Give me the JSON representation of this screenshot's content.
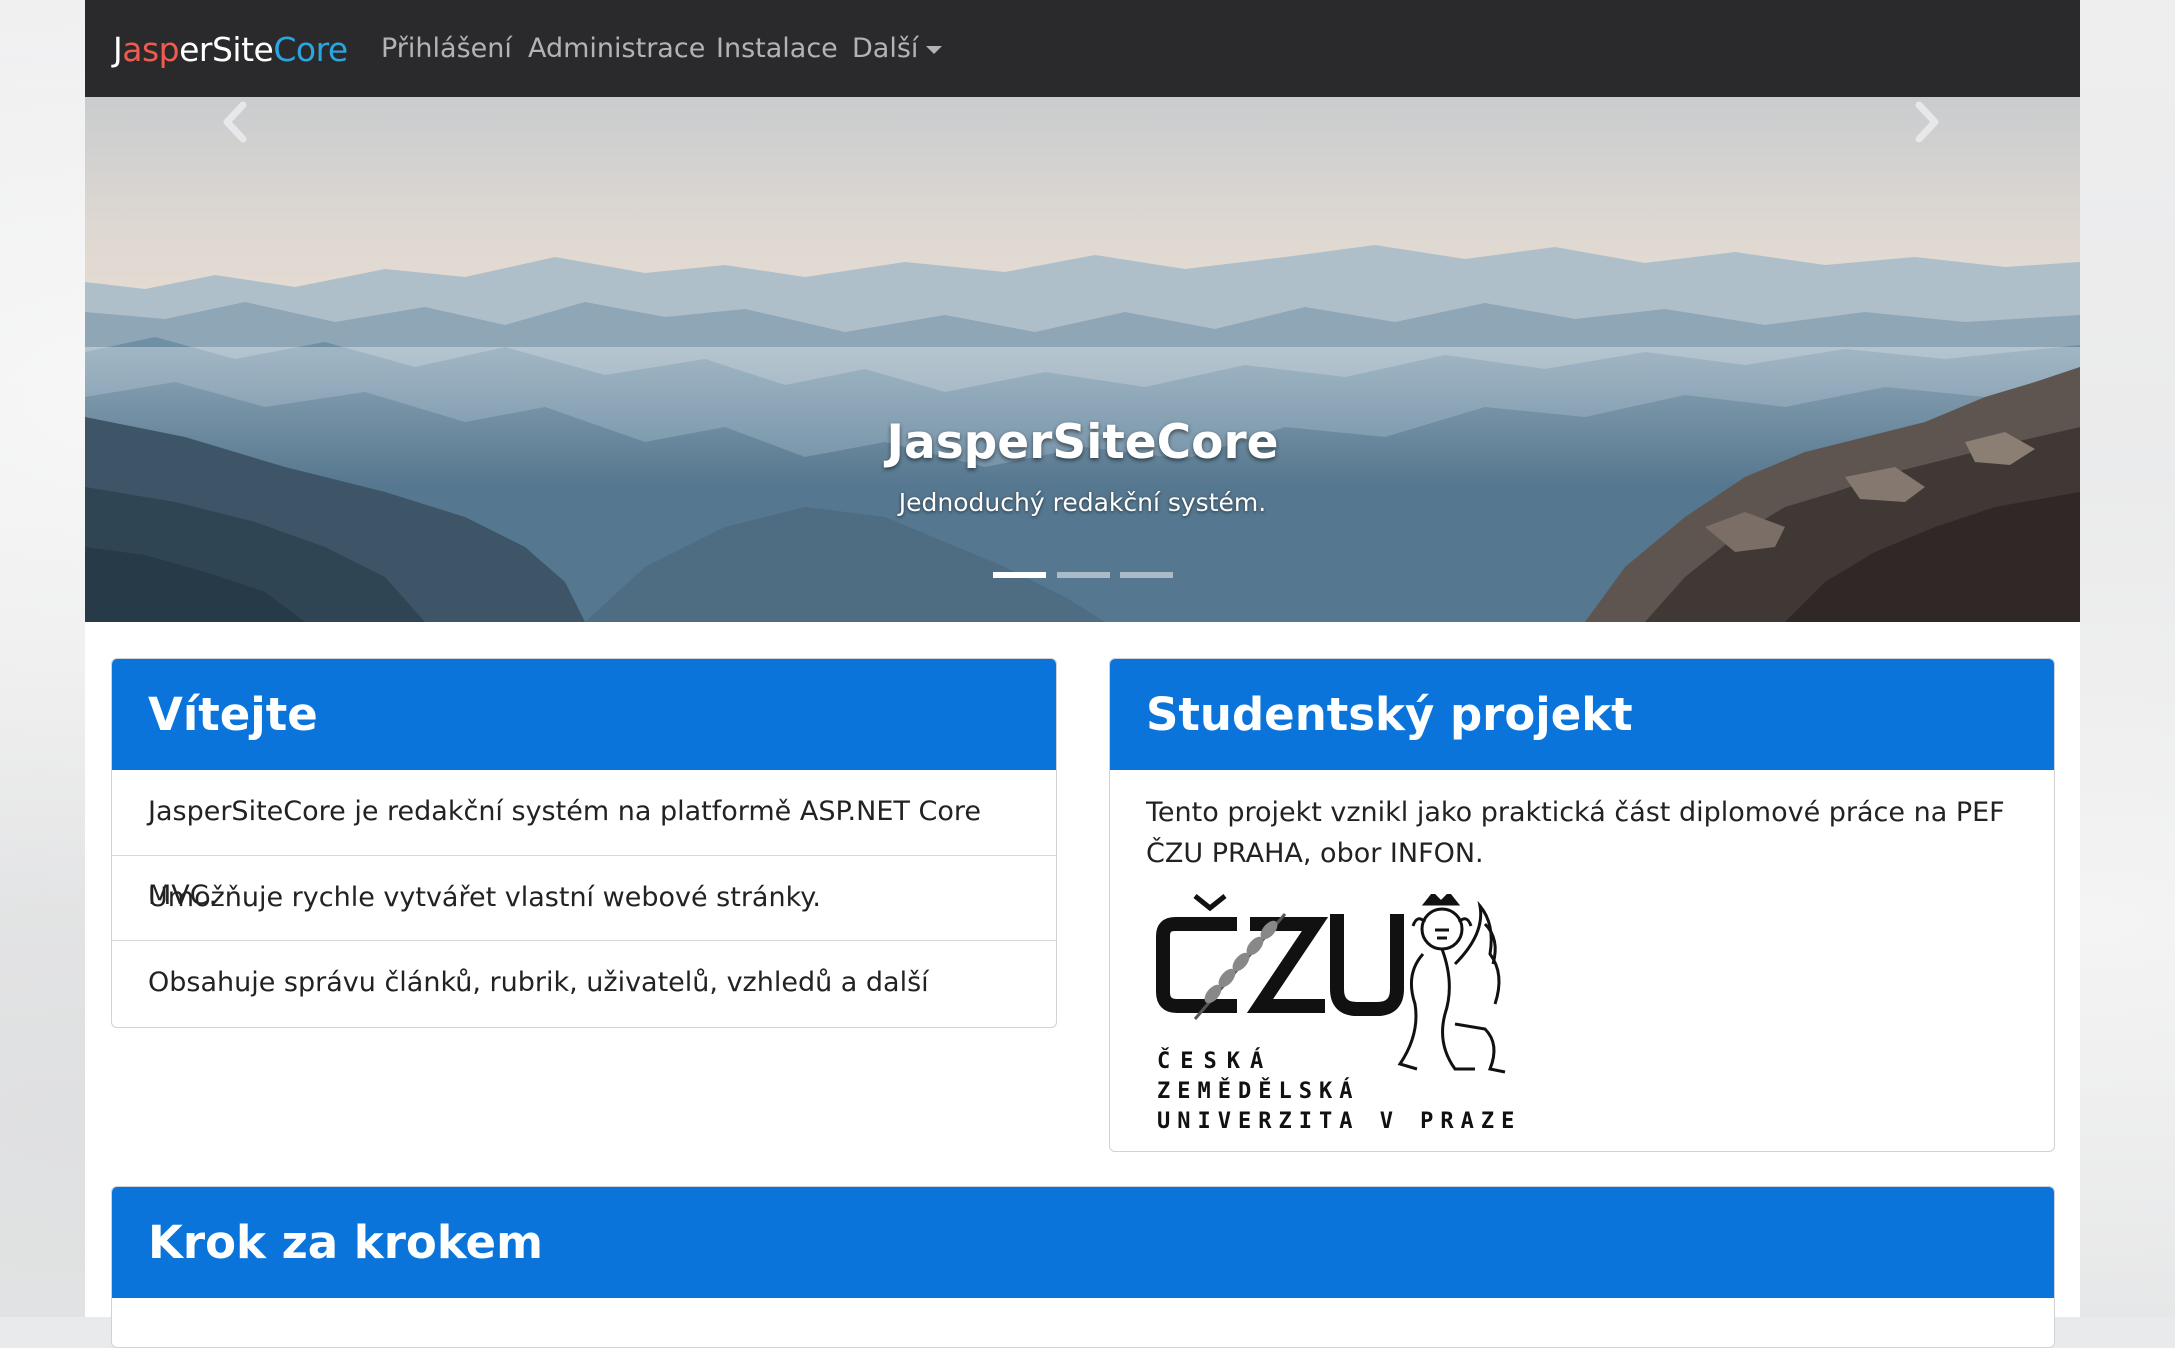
{
  "navbar": {
    "brand": {
      "p1": "J",
      "p2": "asp",
      "p3": "erSite",
      "p4": "Core"
    },
    "items": [
      {
        "label": "Přihlášení"
      },
      {
        "label": "Administrace"
      },
      {
        "label": "Instalace"
      },
      {
        "label": "Další"
      }
    ]
  },
  "carousel": {
    "title": "JasperSiteCore",
    "subtitle": "Jednoduchý redakční systém.",
    "slide_count": 3,
    "active_slide": 1,
    "prev_icon": "chevron-left-icon",
    "next_icon": "chevron-right-icon"
  },
  "welcome": {
    "title": "Vítejte",
    "items": [
      "JasperSiteCore je redakční systém na platformě ASP.NET Core MVC.",
      "Umožňuje rychle vytvářet vlastní webové stránky.",
      "Obsahuje správu článků, rubrik, uživatelů, vzhledů a další nastavení."
    ]
  },
  "project": {
    "title": "Studentský projekt",
    "text": "Tento projekt vznikl jako praktická část diplomové práce na PEF ČZU PRAHA, obor INFON.",
    "logo": {
      "mark": "ČZU",
      "line1": "ČESKÁ",
      "line2": "ZEMĚDĚLSKÁ",
      "line3": "UNIVERZITA V PRAZE"
    }
  },
  "steps": {
    "title": "Krok za krokem"
  },
  "colors": {
    "navbar_bg": "#2a2a2c",
    "panel_header": "#0a74da",
    "brand_red": "#ef5b4e",
    "brand_blue": "#2aa6e0"
  }
}
